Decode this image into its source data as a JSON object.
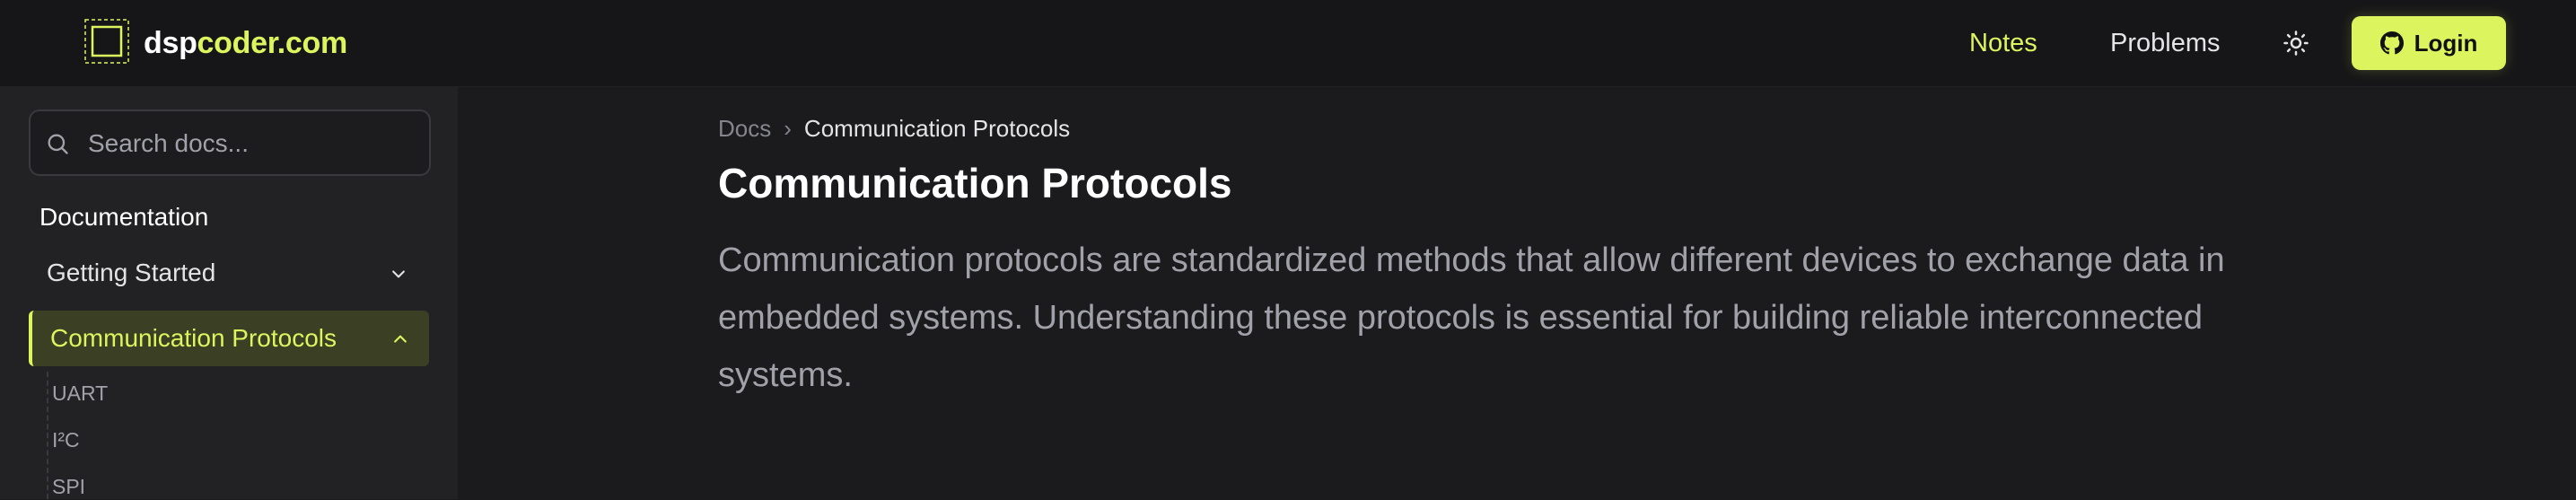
{
  "header": {
    "brand_part1": "dsp",
    "brand_part2": "coder.com",
    "nav": {
      "notes": "Notes",
      "problems": "Problems"
    },
    "login_label": "Login"
  },
  "sidebar": {
    "search_placeholder": "Search docs...",
    "section_title": "Documentation",
    "items": [
      {
        "label": "Getting Started",
        "expanded": false
      },
      {
        "label": "Communication Protocols",
        "expanded": true,
        "active": true,
        "children": [
          "UART",
          "I²C",
          "SPI"
        ]
      }
    ]
  },
  "main": {
    "breadcrumb": {
      "root": "Docs",
      "separator": "›",
      "current": "Communication Protocols"
    },
    "title": "Communication Protocols",
    "intro": "Communication protocols are standardized methods that allow different devices to exchange data in embedded systems. Understanding these protocols is essential for building reliable interconnected systems."
  },
  "colors": {
    "accent": "#dcf55f",
    "background": "#1b1b1d",
    "header_bg": "#161618",
    "sidebar_bg": "#222224",
    "active_item_bg": "#3b3f24",
    "muted_text": "#a1a1aa"
  },
  "icons": {
    "logo": "square-chip-icon",
    "theme_toggle": "sun-icon",
    "login": "github-icon",
    "search": "search-icon",
    "collapsed": "chevron-down-icon",
    "expanded": "chevron-up-icon"
  }
}
